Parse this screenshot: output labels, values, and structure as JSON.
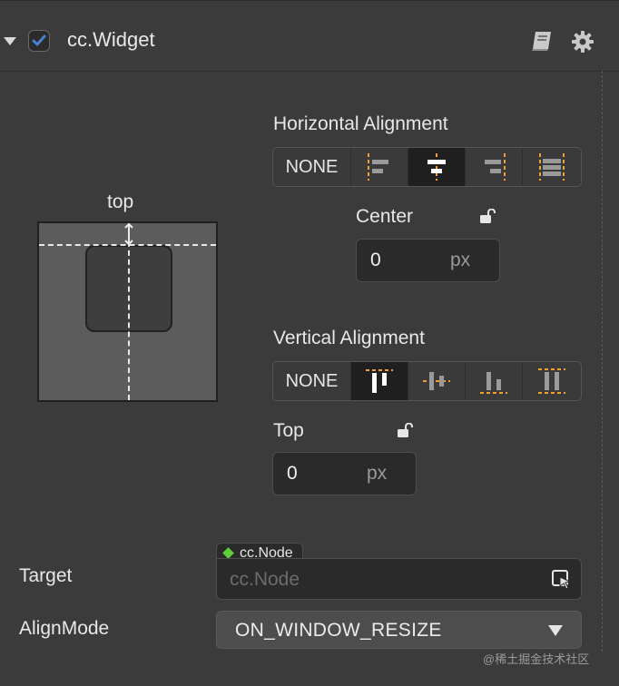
{
  "component": {
    "title": "cc.Widget",
    "enabled": true
  },
  "icons": {
    "fold": "chevron-down-icon",
    "check": "checkmark-icon",
    "docs": "book-icon",
    "settings": "gear-icon",
    "lock": "unlock-icon",
    "picker": "node-picker-icon"
  },
  "preview": {
    "label": "top"
  },
  "horizontal": {
    "label": "Horizontal Alignment",
    "none_label": "NONE",
    "options": [
      "none",
      "left",
      "center",
      "right",
      "stretch"
    ],
    "selected": "center",
    "field_label": "Center",
    "value": "0",
    "unit": "px"
  },
  "vertical": {
    "label": "Vertical Alignment",
    "none_label": "NONE",
    "options": [
      "none",
      "top",
      "middle",
      "bottom",
      "stretch"
    ],
    "selected": "top",
    "field_label": "Top",
    "value": "0",
    "unit": "px"
  },
  "target": {
    "label": "Target",
    "tag": "cc.Node",
    "placeholder": "cc.Node"
  },
  "align_mode": {
    "label": "AlignMode",
    "value": "ON_WINDOW_RESIZE"
  },
  "watermark": "@稀土掘金技术社区",
  "colors": {
    "accent_check": "#4a7fd1",
    "guide_orange": "#f0a030",
    "node_green": "#5fcd3a"
  }
}
